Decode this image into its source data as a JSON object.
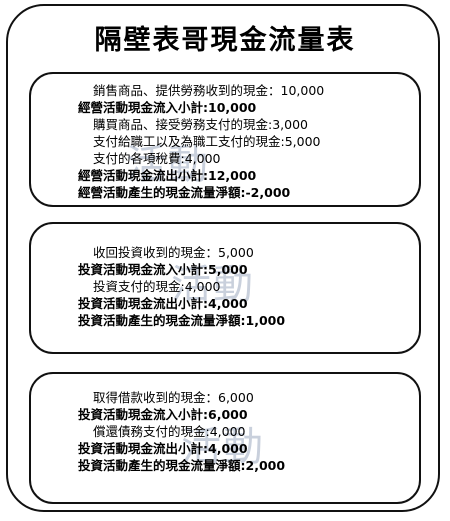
{
  "title": "隔壁表哥現金流量表",
  "sections": [
    {
      "watermark": "活動",
      "lines": [
        {
          "text": "銷售商品、提供勞務收到的現金：10,000",
          "bold": false,
          "indent": 1
        },
        {
          "text": "經營活動現金流入小計:10,000",
          "bold": true,
          "indent": 0
        },
        {
          "text": "購買商品、接受勞務支付的現金:3,000",
          "bold": false,
          "indent": 1
        },
        {
          "text": "支付給職工以及為職工支付的現金:5,000",
          "bold": false,
          "indent": 1
        },
        {
          "text": "支付的各項稅費:4,000",
          "bold": false,
          "indent": 1
        },
        {
          "text": "經營活動現金流出小計:12,000",
          "bold": true,
          "indent": 0
        },
        {
          "text": "經營活動產生的現金流量淨額:-2,000",
          "bold": true,
          "indent": 0
        }
      ]
    },
    {
      "watermark": "活動",
      "lines": [
        {
          "text": "收回投資收到的現金：5,000",
          "bold": false,
          "indent": 1
        },
        {
          "text": "投資活動現金流入小計:5,000",
          "bold": true,
          "indent": 0
        },
        {
          "text": "投資支付的現金:4,000",
          "bold": false,
          "indent": 1
        },
        {
          "text": "投資活動現金流出小計:4,000",
          "bold": true,
          "indent": 0
        },
        {
          "text": "投資活動產生的現金流量淨額:1,000",
          "bold": true,
          "indent": 0
        }
      ]
    },
    {
      "watermark": "活動",
      "lines": [
        {
          "text": "取得借款收到的現金：6,000",
          "bold": false,
          "indent": 1
        },
        {
          "text": "投資活動現金流入小計:6,000",
          "bold": true,
          "indent": 0
        },
        {
          "text": "償還債務支付的現金:4,000",
          "bold": false,
          "indent": 1
        },
        {
          "text": "投資活動現金流出小計:4,000",
          "bold": true,
          "indent": 0
        },
        {
          "text": "投資活動產生的現金流量淨額:2,000",
          "bold": true,
          "indent": 0
        }
      ]
    }
  ]
}
